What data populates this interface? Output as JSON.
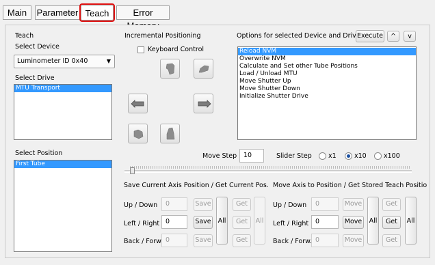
{
  "tabs": [
    "Main",
    "Parameter",
    "Teach",
    "Error Memory"
  ],
  "teach": {
    "group_title": "Teach",
    "select_device_label": "Select Device",
    "device_value": "Luminometer ID 0x40",
    "select_drive_label": "Select Drive",
    "drives": [
      "MTU Transport"
    ],
    "select_position_label": "Select Position",
    "positions": [
      "First Tube"
    ]
  },
  "incremental": {
    "title": "Incremental Positioning",
    "keyboard_control": "Keyboard Control",
    "keyboard_checked": false
  },
  "options": {
    "title": "Options for selected Device and Drive",
    "execute": "Execute",
    "up": "^",
    "down": "v",
    "items": [
      "Reload NVM",
      "Overwrite NVM",
      "Calculate and Set other Tube Positions",
      "Load / Unload MTU",
      "Move Shutter Up",
      "Move Shutter Down",
      "Initialize Shutter Drive"
    ],
    "selected_index": 0
  },
  "move": {
    "step_label": "Move Step",
    "step_value": "10",
    "slider_label": "Slider Step",
    "radios": [
      "x1",
      "x10",
      "x100"
    ],
    "selected_radio": "x10"
  },
  "save_section": {
    "title": "Save Current Axis Position / Get Current Pos.",
    "rows": [
      {
        "label": "Up / Down",
        "value": "0",
        "enabled": false
      },
      {
        "label": "Left / Right",
        "value": "0",
        "enabled": true
      },
      {
        "label": "Back / Forw.",
        "value": "0",
        "enabled": false
      }
    ],
    "save": "Save",
    "get": "Get",
    "all": "All"
  },
  "move_section": {
    "title": "Move Axis to Position / Get Stored Teach Positio",
    "rows": [
      {
        "label": "Up / Down",
        "value": "0",
        "enabled": false
      },
      {
        "label": "Left / Right",
        "value": "0",
        "enabled": true
      },
      {
        "label": "Back / Forw.",
        "value": "0",
        "enabled": false
      }
    ],
    "move": "Move",
    "get": "Get",
    "all": "All"
  }
}
